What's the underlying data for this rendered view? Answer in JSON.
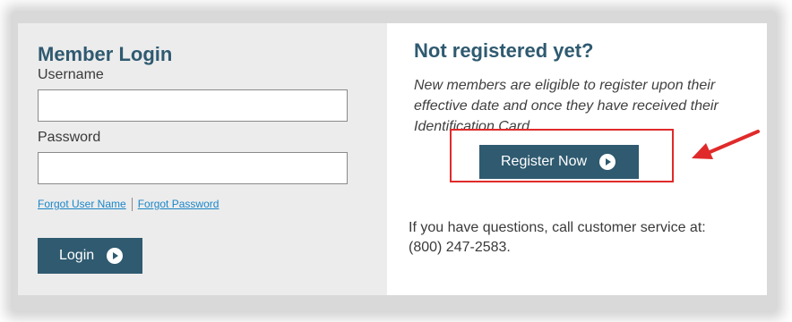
{
  "login": {
    "title": "Member Login",
    "username_label": "Username",
    "username_value": "",
    "password_label": "Password",
    "password_value": "",
    "forgot_username": "Forgot User Name",
    "forgot_password": "Forgot Password",
    "login_button": "Login"
  },
  "register": {
    "title": "Not registered yet?",
    "description": "New members are eligible to register upon their effective date and once they have received their Identification Card.",
    "button": "Register Now",
    "help_text": "If you have questions, call customer service at:",
    "phone": "(800) 247-2583."
  },
  "colors": {
    "brand": "#2f5a70",
    "panel_bg": "#ececec",
    "link": "#1a86c8",
    "highlight": "#e02a2a"
  },
  "icons": {
    "button_icon": "arrow-circle-right-icon",
    "annotation": "red-arrow-icon"
  }
}
